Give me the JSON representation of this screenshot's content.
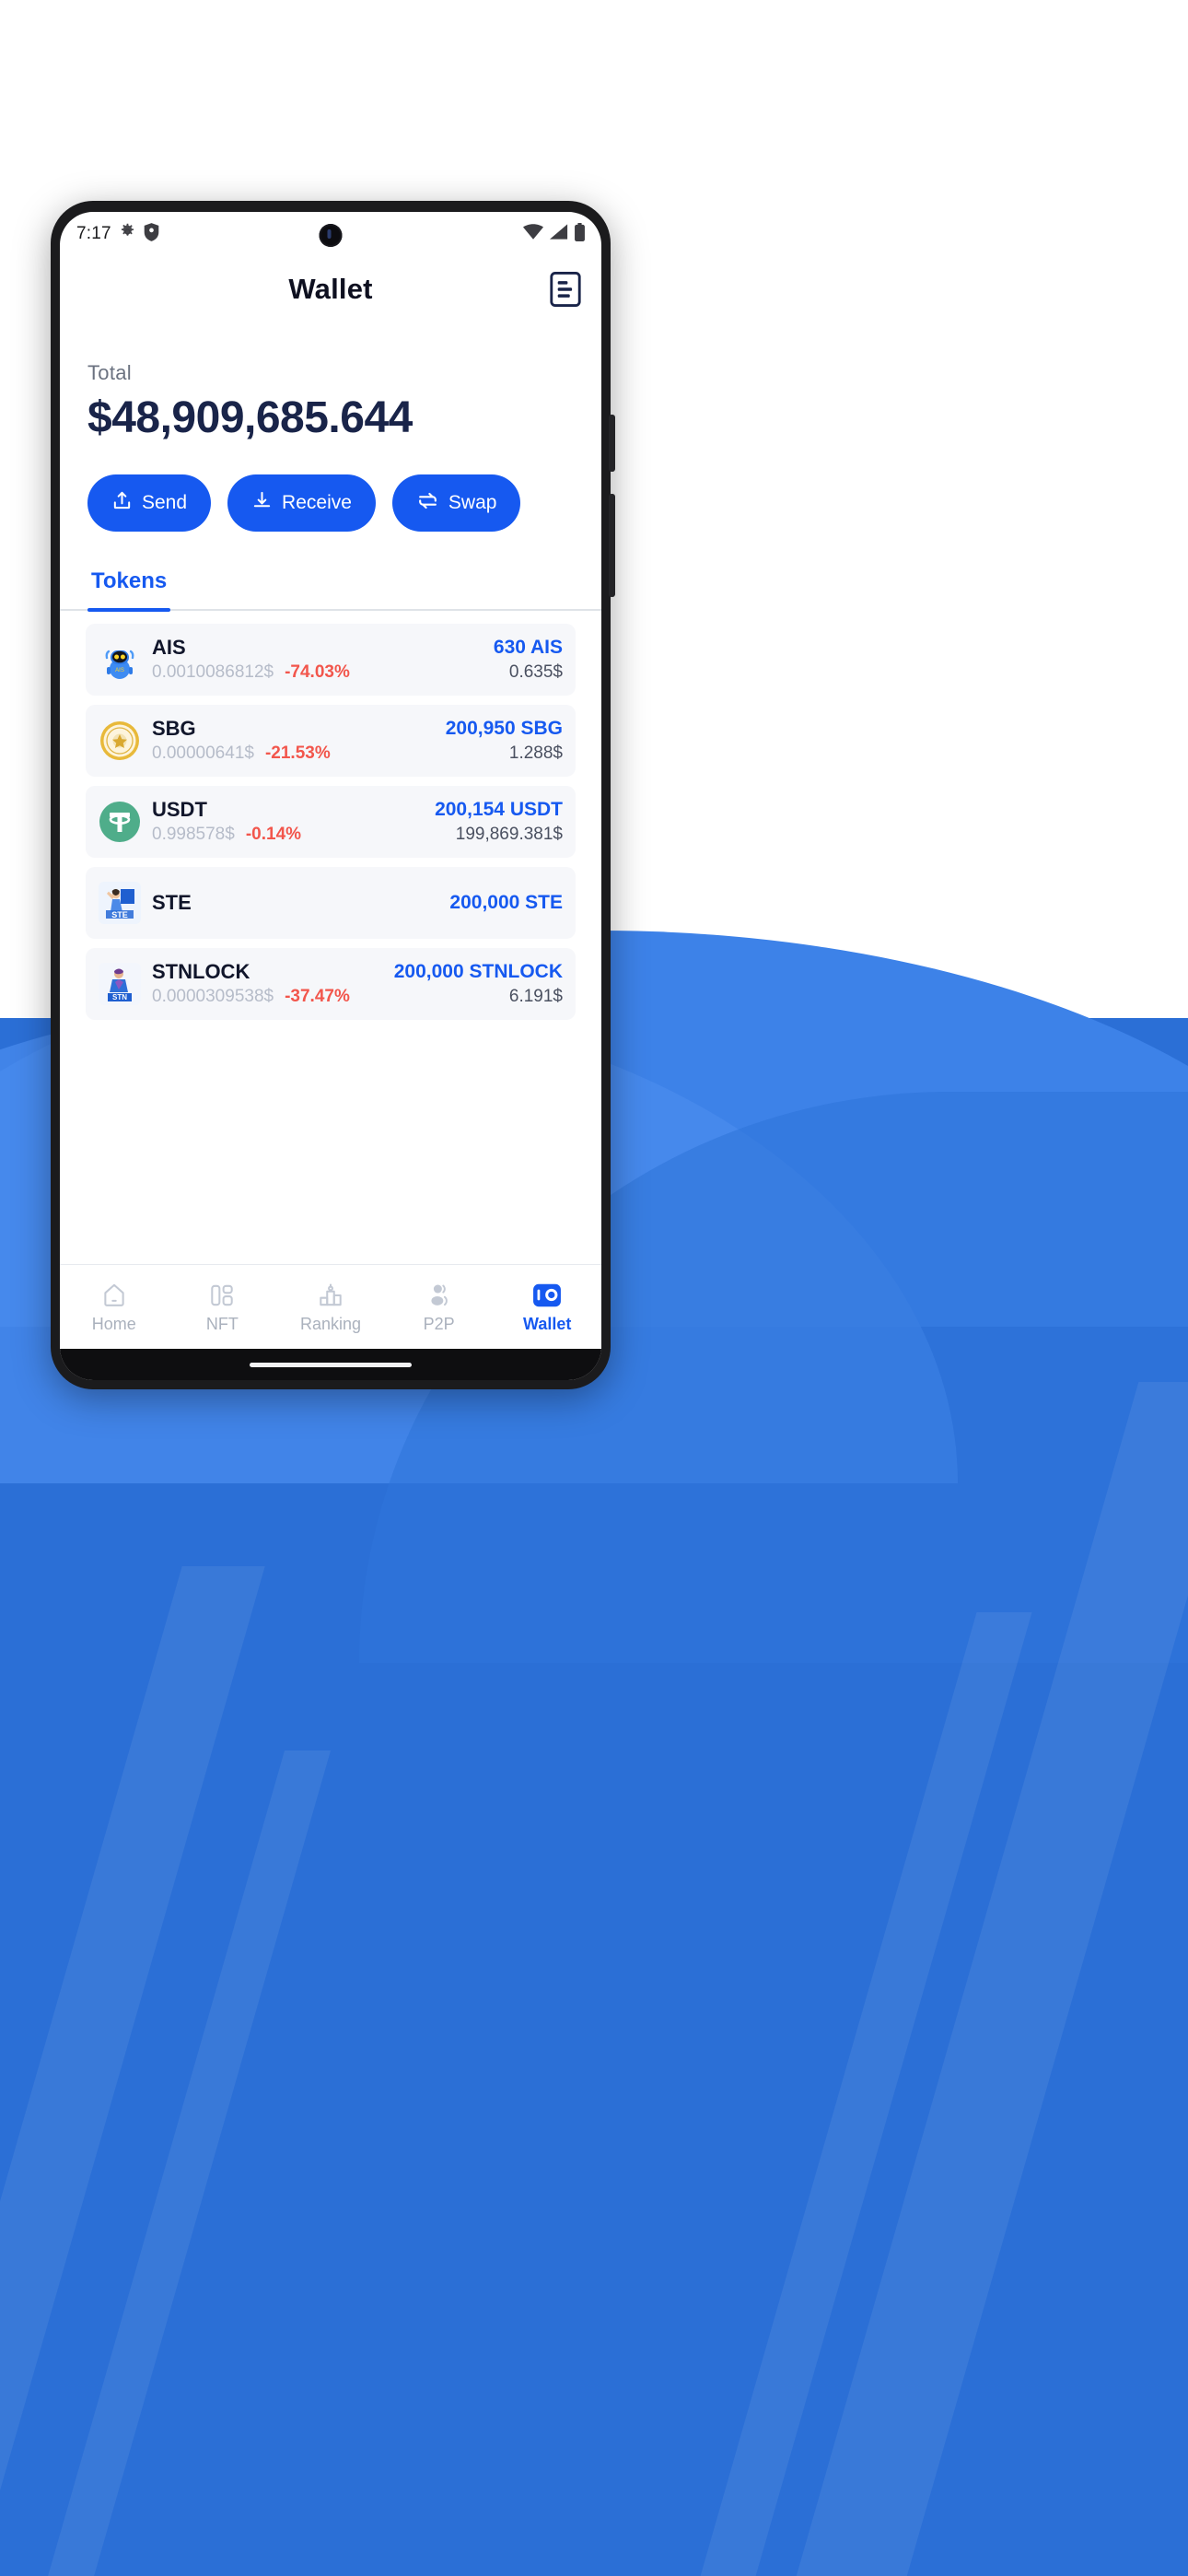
{
  "status_bar": {
    "time": "7:17",
    "left_icons": [
      "gear-icon",
      "shield-icon"
    ],
    "right_icons": [
      "wifi-icon",
      "signal-icon",
      "battery-icon"
    ]
  },
  "app_bar": {
    "title": "Wallet",
    "action_icon": "document-list-icon"
  },
  "balance": {
    "label": "Total",
    "amount": "$48,909,685.644"
  },
  "actions": [
    {
      "label": "Send",
      "icon": "upload-icon"
    },
    {
      "label": "Receive",
      "icon": "download-icon"
    },
    {
      "label": "Swap",
      "icon": "swap-icon"
    }
  ],
  "tabs": [
    {
      "label": "Tokens",
      "active": true
    }
  ],
  "tokens": [
    {
      "symbol": "AIS",
      "icon": "ais-robot-icon",
      "price": "0.0010086812$",
      "change": "-74.03%",
      "amount": "630 AIS",
      "value": "0.635$"
    },
    {
      "symbol": "SBG",
      "icon": "sbg-gold-coin-icon",
      "price": "0.00000641$",
      "change": "-21.53%",
      "amount": "200,950 SBG",
      "value": "1.288$"
    },
    {
      "symbol": "USDT",
      "icon": "usdt-tether-icon",
      "price": "0.998578$",
      "change": "-0.14%",
      "amount": "200,154 USDT",
      "value": "199,869.381$"
    },
    {
      "symbol": "STE",
      "icon": "ste-character-icon",
      "price": "",
      "change": "",
      "amount": "200,000 STE",
      "value": ""
    },
    {
      "symbol": "STNLOCK",
      "icon": "stnlock-character-icon",
      "price": "0.0000309538$",
      "change": "-37.47%",
      "amount": "200,000 STNLOCK",
      "value": "6.191$"
    }
  ],
  "bottom_nav": [
    {
      "label": "Home",
      "icon": "home-icon",
      "active": false
    },
    {
      "label": "NFT",
      "icon": "nft-icon",
      "active": false
    },
    {
      "label": "Ranking",
      "icon": "ranking-icon",
      "active": false
    },
    {
      "label": "P2P",
      "icon": "p2p-icon",
      "active": false
    },
    {
      "label": "Wallet",
      "icon": "wallet-icon",
      "active": true
    }
  ],
  "colors": {
    "accent": "#1659f0",
    "balance_text": "#192449",
    "negative": "#f2564c",
    "row_bg": "#f6f7fa",
    "wallpaper": "#2b6fd6"
  }
}
